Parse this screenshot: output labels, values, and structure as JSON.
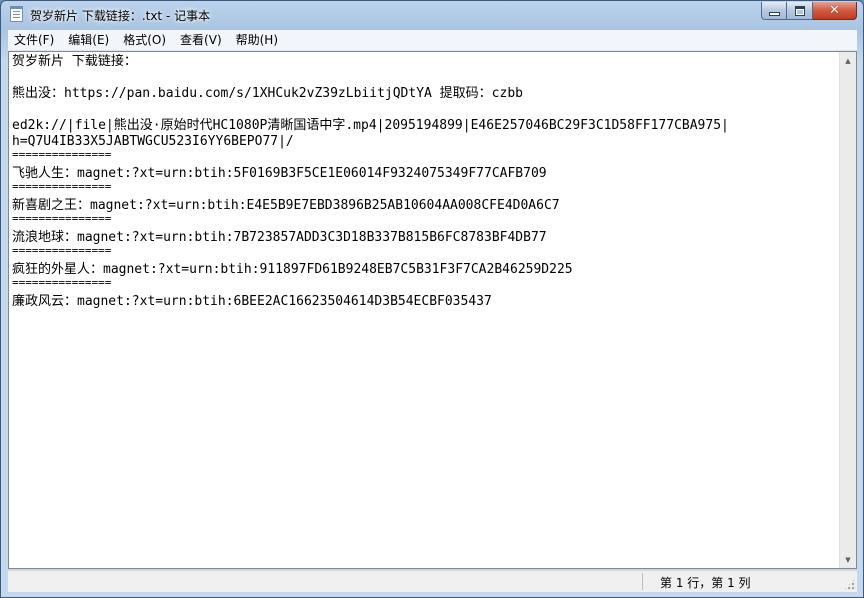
{
  "window": {
    "title": "贺岁新片 下载链接：.txt - 记事本",
    "icon": "notepad-icon",
    "buttons": {
      "minimize": "minimize-icon",
      "maximize": "maximize-icon",
      "close": "close-icon"
    }
  },
  "menu": [
    {
      "label": "文件(F)"
    },
    {
      "label": "编辑(E)"
    },
    {
      "label": "格式(O)"
    },
    {
      "label": "查看(V)"
    },
    {
      "label": "帮助(H)"
    }
  ],
  "document": {
    "heading": "贺岁新片 下载链接：",
    "pan_line": "熊出没：https://pan.baidu.com/s/1XHCuk2vZ39zLbiitjQDtYA 提取码：czbb",
    "ed2k_line1": "ed2k://|file|熊出没·原始时代HC1080P清晰国语中字.mp4|2095194899|E46E257046BC29F3C1D58FF177CBA975|",
    "ed2k_line2": "h=Q7U4IB33X5JABTWGCU523I6YY6BEPO77|/",
    "separator": "===============",
    "m1": "飞驰人生：magnet:?xt=urn:btih:5F0169B3F5CE1E06014F9324075349F77CAFB709",
    "m2": "新喜剧之王：magnet:?xt=urn:btih:E4E5B9E7EBD3896B25AB10604AA008CFE4D0A6C7",
    "m3": "流浪地球：magnet:?xt=urn:btih:7B723857ADD3C3D18B337B815B6FC8783BF4DB77",
    "m4": "疯狂的外星人：magnet:?xt=urn:btih:911897FD61B9248EB7C5B31F3F7CA2B46259D225",
    "m5": "廉政风云：magnet:?xt=urn:btih:6BEE2AC16623504614D3B54ECBF035437"
  },
  "status": {
    "position": "第 1 行，第 1 列"
  }
}
